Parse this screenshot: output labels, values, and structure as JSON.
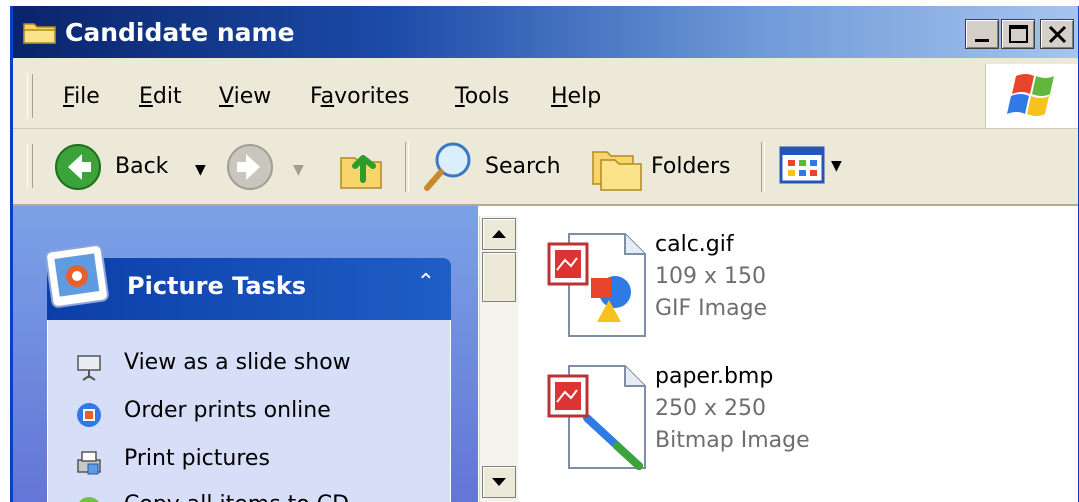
{
  "window": {
    "title": "Candidate name"
  },
  "menu": {
    "items": [
      {
        "label": "File",
        "accel": "F",
        "rest": "ile"
      },
      {
        "label": "Edit",
        "accel": "E",
        "rest": "dit"
      },
      {
        "label": "View",
        "accel": "V",
        "rest": "iew"
      },
      {
        "label": "Favorites",
        "pre": "F",
        "accel": "a",
        "rest": "vorites"
      },
      {
        "label": "Tools",
        "accel": "T",
        "rest": "ools"
      },
      {
        "label": "Help",
        "accel": "H",
        "rest": "elp"
      }
    ]
  },
  "toolbar": {
    "back_label": "Back",
    "search_label": "Search",
    "folders_label": "Folders"
  },
  "tasks": {
    "title": "Picture Tasks",
    "items": [
      {
        "label": "View as a slide show",
        "icon": "slideshow-icon"
      },
      {
        "label": "Order prints online",
        "icon": "order-prints-icon"
      },
      {
        "label": "Print pictures",
        "icon": "print-icon"
      },
      {
        "label": "Copy all items to CD",
        "icon": "cd-icon"
      }
    ]
  },
  "files": [
    {
      "name": "calc.gif",
      "dimensions": "109 x 150",
      "type": "GIF Image"
    },
    {
      "name": "paper.bmp",
      "dimensions": "250 x 250",
      "type": "Bitmap Image"
    }
  ],
  "colors": {
    "title_bar": "#0a246a",
    "task_header": "#0c3ea8",
    "task_body": "#d6dff7"
  }
}
